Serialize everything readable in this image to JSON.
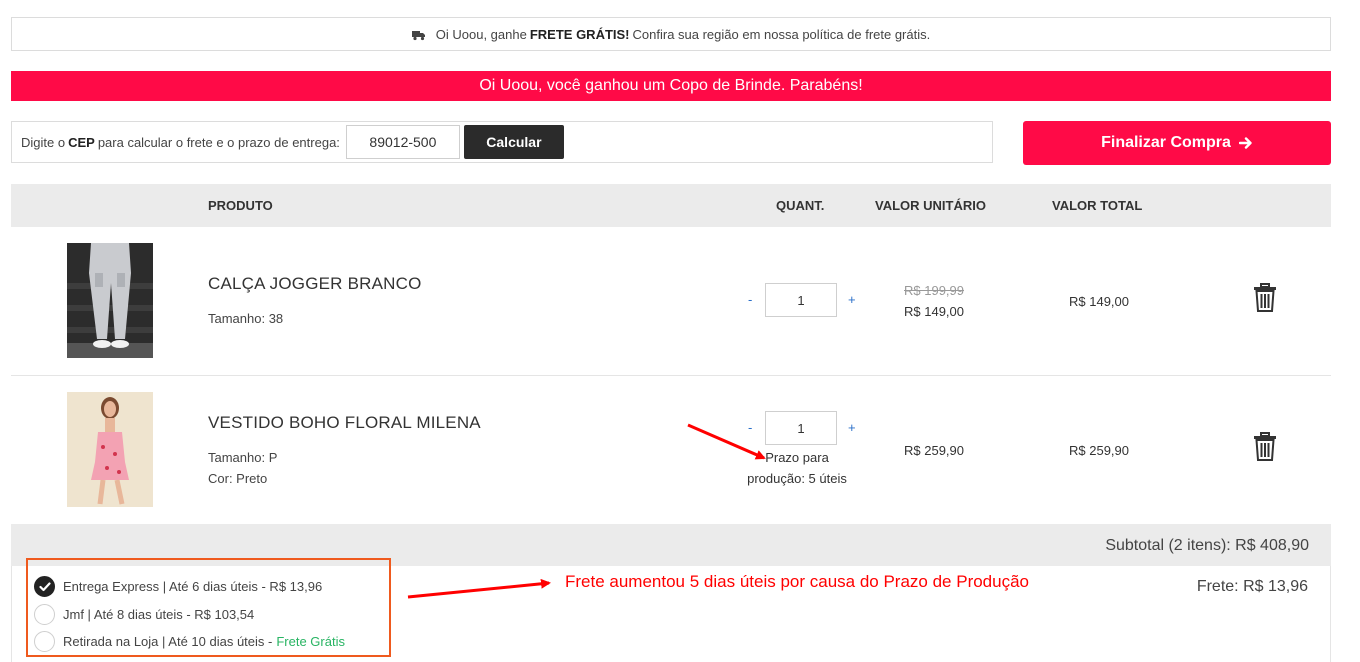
{
  "promo": {
    "icon": "truck-icon",
    "prefix": "Oi Uoou, ganhe",
    "highlight": "FRETE GRÁTIS!",
    "suffix": "Confira sua região em nossa política de frete grátis."
  },
  "gift_banner": "Oi Uoou, você ganhou um Copo de Brinde. Parabéns!",
  "cep": {
    "label_prefix": "Digite o",
    "label_bold": "CEP",
    "label_suffix": "para calcular o frete e o prazo de entrega:",
    "value": "89012-500",
    "button": "Calcular"
  },
  "checkout_button": "Finalizar Compra",
  "table": {
    "headers": {
      "product": "PRODUTO",
      "qty": "QUANT.",
      "unit": "VALOR UNITÁRIO",
      "total": "VALOR TOTAL"
    },
    "items": [
      {
        "name": "CALÇA JOGGER BRANCO",
        "attrs": [
          "Tamanho: 38"
        ],
        "qty": "1",
        "minus": "-",
        "plus": "+",
        "old_price": "R$ 199,99",
        "unit_price": "R$ 149,00",
        "total": "R$ 149,00"
      },
      {
        "name": "VESTIDO BOHO FLORAL MILENA",
        "attrs": [
          "Tamanho: P",
          "Cor: Preto"
        ],
        "qty": "1",
        "minus": "-",
        "plus": "+",
        "production_line1": "Prazo para",
        "production_line2": "produção: 5 úteis",
        "unit_price": "R$ 259,90",
        "total": "R$ 259,90"
      }
    ]
  },
  "subtotal": "Subtotal (2 itens): R$ 408,90",
  "shipping": {
    "options": [
      {
        "label": "Entrega Express | Até 6 dias úteis - R$ 13,96",
        "selected": true
      },
      {
        "label": "Jmf | Até 8 dias úteis - R$ 103,54",
        "selected": false
      },
      {
        "label": "Retirada na Loja | Até 10 dias úteis - ",
        "extra": "Frete Grátis",
        "selected": false
      }
    ],
    "frete": "Frete: R$ 13,96"
  },
  "annotation": "Frete aumentou 5 dias úteis por causa do Prazo de Produção",
  "colors": {
    "accent": "#ff0a47",
    "dark_button": "#2b2b2b",
    "annotation": "#ff0000",
    "annotation_box": "#ef5a1e",
    "free_shipping": "#28b463"
  }
}
